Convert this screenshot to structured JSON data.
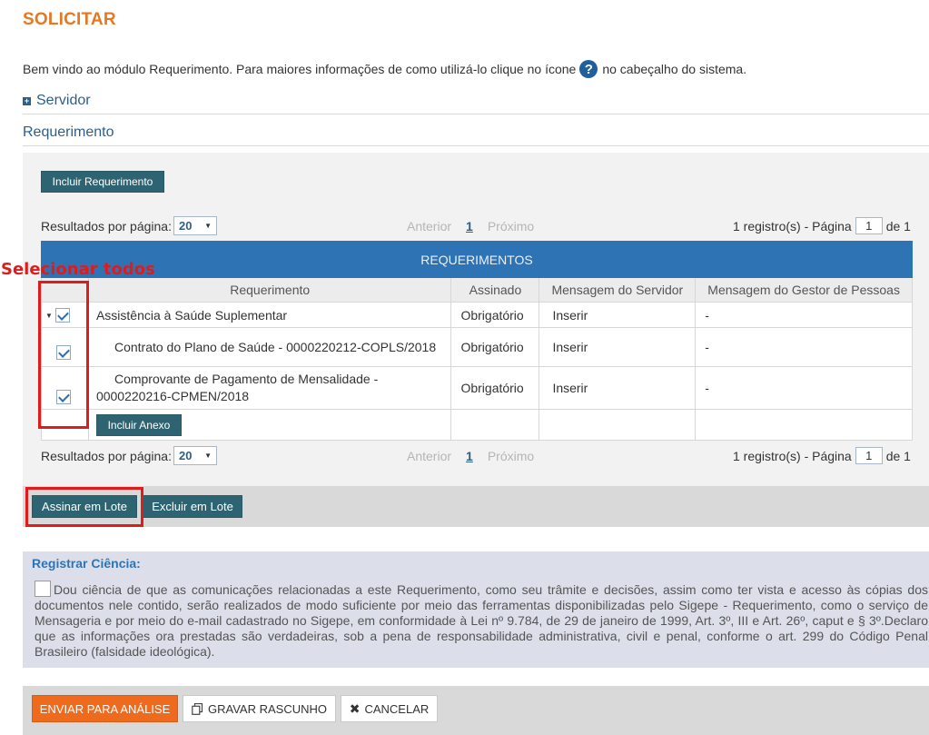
{
  "page": {
    "title": "SOLICITAR",
    "welcome_before": "Bem vindo ao módulo Requerimento. Para maiores informações de como utilizá-lo clique no ícone",
    "help_glyph": "?",
    "welcome_after": "no cabeçalho do sistema."
  },
  "sections": {
    "servidor": "Servidor",
    "servidor_toggle": "+",
    "requerimento": "Requerimento"
  },
  "actions": {
    "incluir_requerimento": "Incluir Requerimento",
    "incluir_anexo": "Incluir Anexo",
    "assinar_lote": "Assinar em Lote",
    "excluir_lote": "Excluir em Lote"
  },
  "pagination": {
    "results_label": "Resultados por página:",
    "per_page": "20",
    "prev": "Anterior",
    "current": "1",
    "next": "Próximo",
    "records_label": "1 registro(s) - Página",
    "page_value": "1",
    "of_label": "de 1"
  },
  "table": {
    "caption": "REQUERIMENTOS",
    "headers": [
      "Requerimento",
      "Assinado",
      "Mensagem do Servidor",
      "Mensagem do Gestor de Pessoas"
    ],
    "rows": [
      {
        "name": "Assistência à Saúde Suplementar",
        "signed": "Obrigatório",
        "server_msg": "Inserir",
        "manager_msg": "-",
        "checked": true
      },
      {
        "name": "Contrato do Plano de Saúde - 0000220212-COPLS/2018",
        "signed": "Obrigatório",
        "server_msg": "Inserir",
        "manager_msg": "-",
        "checked": true
      },
      {
        "name_line1": "Comprovante de Pagamento de Mensalidade -",
        "name_line2": "0000220216-CPMEN/2018",
        "signed": "Obrigatório",
        "server_msg": "Inserir",
        "manager_msg": "-",
        "checked": true
      }
    ]
  },
  "annotation": {
    "select_all": "Selecionar todos"
  },
  "ciencia": {
    "title": "Registrar Ciência:",
    "text": "Dou ciência de que as comunicações relacionadas a este Requerimento, como seu trâmite e decisões, assim como ter vista e acesso às cópias dos documentos nele contido, serão realizados de modo suficiente por meio das ferramentas disponibilizadas pelo Sigepe - Requerimento, como o serviço de Mensageria e por meio do e-mail cadastrado no Sigepe, em conformidade à Lei nº 9.784, de 29 de janeiro de 1999, Art. 3º, III e Art. 26º, caput e § 3º.Declaro que as informações ora prestadas são verdadeiras, sob a pena de responsabilidade administrativa, civil e penal, conforme o art. 299 do Código Penal Brasileiro (falsidade ideológica).",
    "checked": false
  },
  "footer": {
    "enviar": "ENVIAR PARA ANÁLISE",
    "gravar": "GRAVAR RASCUNHO",
    "cancelar": "CANCELAR",
    "gravar_icon": "copy-icon",
    "cancelar_icon": "close-icon"
  },
  "colors": {
    "title": "#e87722",
    "section": "#2e5f8a",
    "table_caption_bg": "#2e74b5",
    "dark_button": "#2e6472",
    "primary_button": "#ee6a1c",
    "annotation_red": "#e01b1b"
  }
}
